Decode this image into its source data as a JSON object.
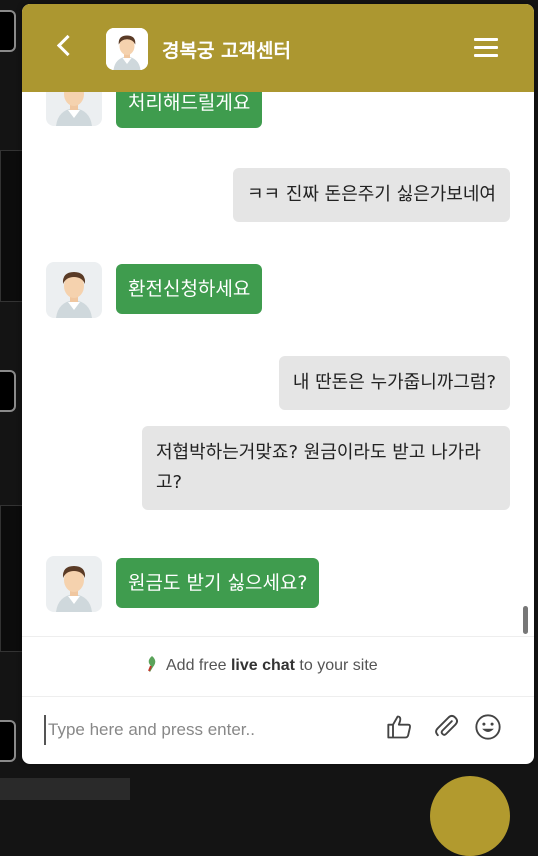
{
  "header": {
    "title": "경복궁 고객센터"
  },
  "messages": [
    {
      "from": "agent",
      "text": "처리해드릴게요"
    },
    {
      "from": "user",
      "text": "ㅋㅋ 진짜 돈은주기 싫은가보네여"
    },
    {
      "from": "agent",
      "text": "환전신청하세요"
    },
    {
      "from": "user",
      "text": "내 딴돈은 누가줍니까그럼?"
    },
    {
      "from": "user",
      "text": "저협박하는거맞죠? 원금이라도 받고 나가라고?"
    },
    {
      "from": "agent",
      "text": "원금도 받기 싫으세요?"
    }
  ],
  "promo": {
    "prefix": "Add free ",
    "bold": "live chat",
    "suffix": " to your site"
  },
  "composer": {
    "placeholder": "Type here and press enter.."
  },
  "icons": {
    "back": "chevron-left-icon",
    "menu": "hamburger-menu-icon",
    "like": "thumbs-up-icon",
    "attach": "paperclip-icon",
    "emoji": "smiley-icon"
  },
  "colors": {
    "header": "#ac9730",
    "agent_bubble": "#3f9c4e",
    "user_bubble": "#e5e5e5"
  }
}
